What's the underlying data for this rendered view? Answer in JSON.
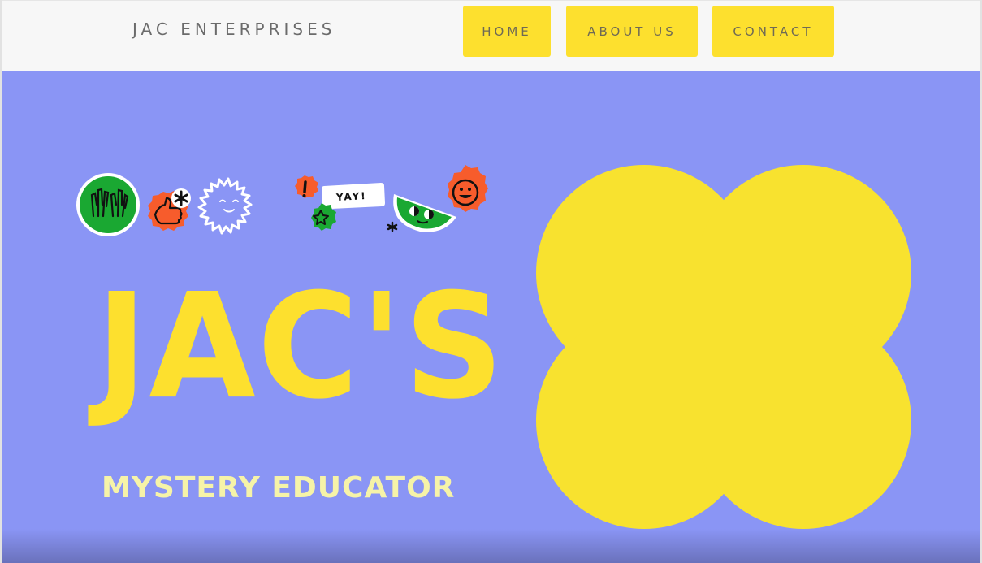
{
  "header": {
    "brand": "JAC ENTERPRISES",
    "nav": [
      {
        "label": "HOME"
      },
      {
        "label": "ABOUT US"
      },
      {
        "label": "CONTACT"
      }
    ]
  },
  "hero": {
    "title": "JAC'S",
    "subtitle": "MYSTERY EDUCATOR",
    "sticker_text": "YAY!",
    "stickers": [
      "clapping-hands-sticker",
      "thumbs-up-sticker",
      "asterisk-sticker",
      "sun-face-sticker",
      "exclamation-sticker",
      "yay-speech-bubble",
      "star-sticker",
      "half-moon-face-sticker",
      "smiley-face-sticker"
    ]
  },
  "colors": {
    "header_bg": "#f7f7f7",
    "nav_button": "#fde02e",
    "hero_bg": "#8a95f5",
    "title_yellow": "#fde02e",
    "subtitle_yellow": "#f6f3a8",
    "blob_yellow": "#f8e22f",
    "sticker_green": "#1aa832",
    "sticker_orange": "#f75c2c"
  }
}
